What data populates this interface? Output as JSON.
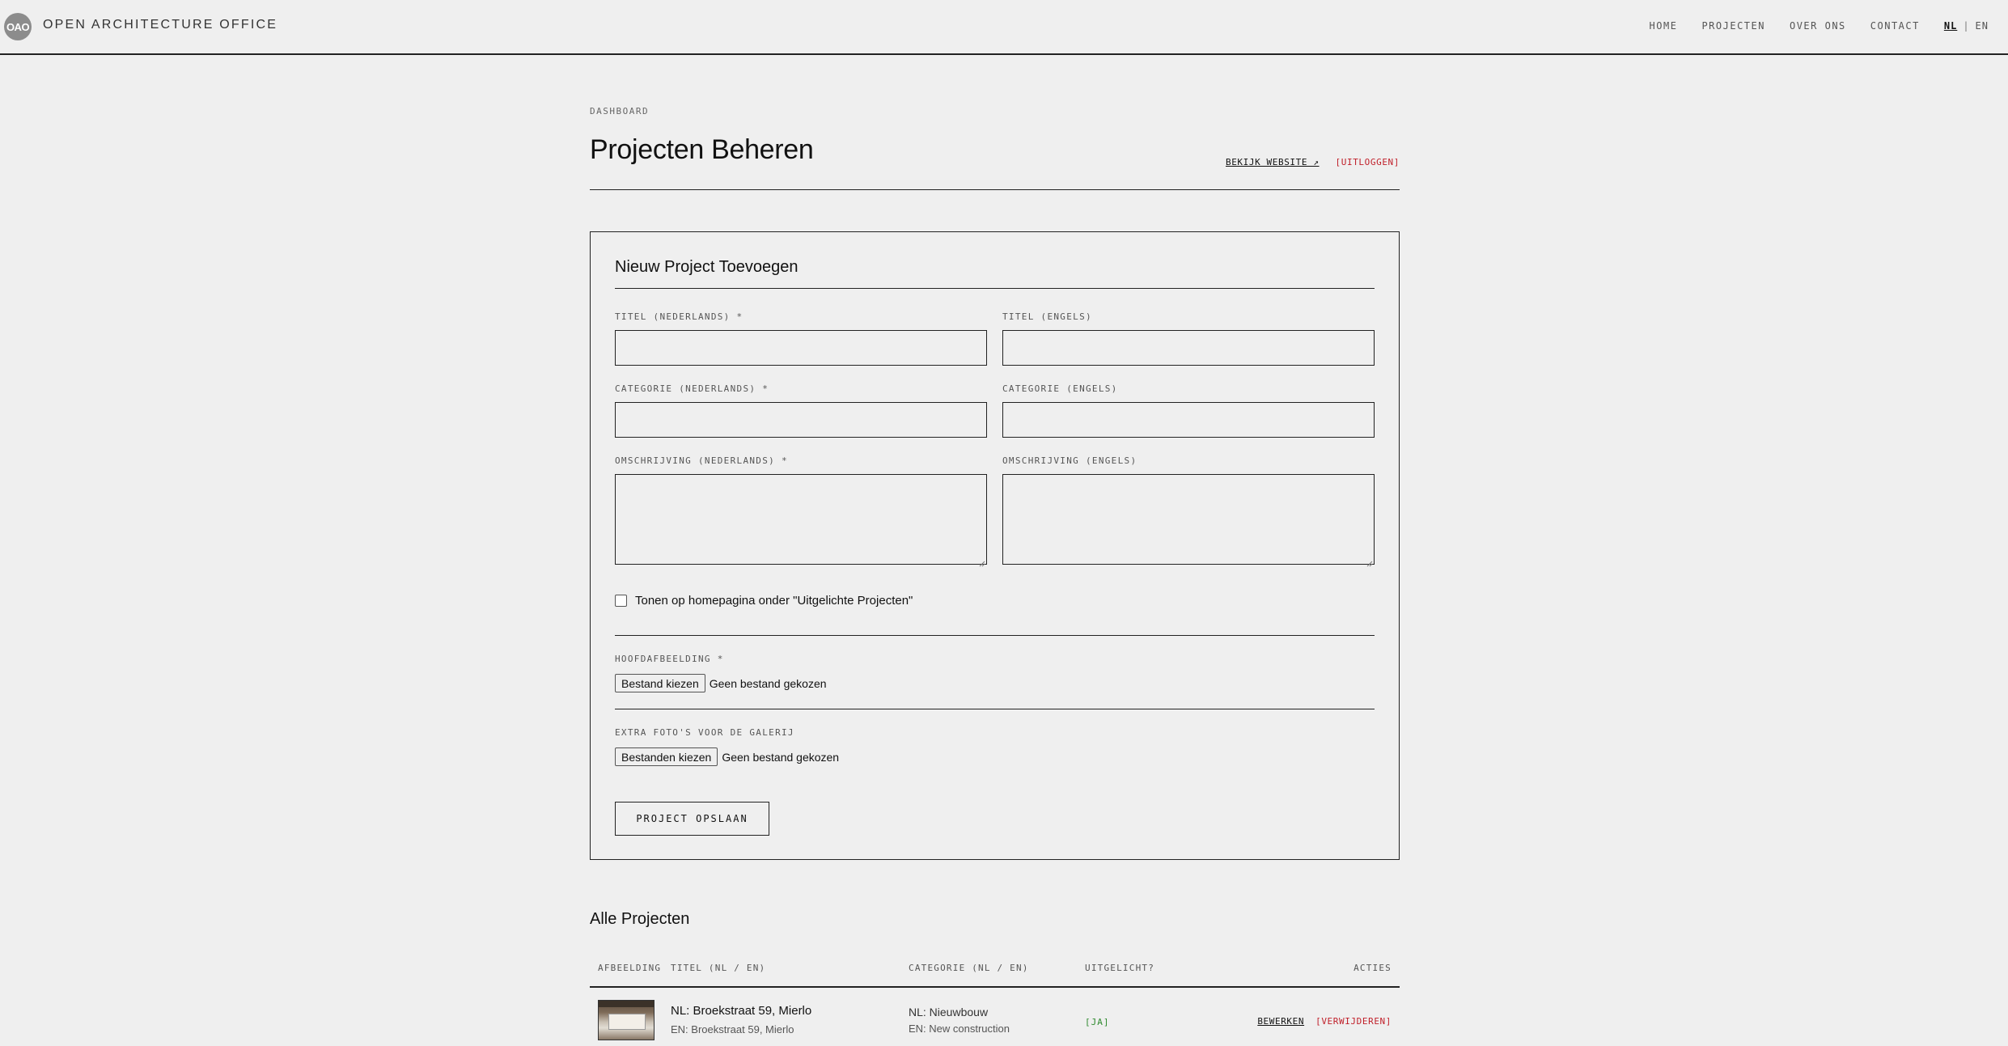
{
  "header": {
    "logo_text": "OAO",
    "brand": "OPEN ARCHITECTURE OFFICE",
    "nav": [
      "HOME",
      "PROJECTEN",
      "OVER ONS",
      "CONTACT"
    ],
    "lang_active": "NL",
    "lang_sep": "|",
    "lang_other": "EN"
  },
  "dashboard": {
    "breadcrumb": "DASHBOARD",
    "title": "Projecten Beheren",
    "view_site": "BEKIJK WEBSITE ↗",
    "logout": "[UITLOGGEN]"
  },
  "form": {
    "title": "Nieuw Project Toevoegen",
    "title_nl_label": "TITEL (NEDERLANDS) *",
    "title_en_label": "TITEL (ENGELS)",
    "category_nl_label": "CATEGORIE (NEDERLANDS) *",
    "category_en_label": "CATEGORIE (ENGELS)",
    "description_nl_label": "OMSCHRIJVING (NEDERLANDS) *",
    "description_en_label": "OMSCHRIJVING (ENGELS)",
    "title_nl_value": "",
    "title_en_value": "",
    "category_nl_value": "",
    "category_en_value": "",
    "featured_label": "Tonen op homepagina onder \"Uitgelichte Projecten\"",
    "featured_checked": false,
    "main_image_label": "HOOFDAFBEELDING *",
    "main_image_button": "Bestand kiezen",
    "main_image_status": "Geen bestand gekozen",
    "gallery_label": "EXTRA FOTO'S VOOR DE GALERIJ",
    "gallery_button": "Bestanden kiezen",
    "gallery_status": "Geen bestand gekozen",
    "save_button": "PROJECT OPSLAAN"
  },
  "projects": {
    "title": "Alle Projecten",
    "columns": [
      "AFBEELDING",
      "TITEL (NL / EN)",
      "CATEGORIE (NL / EN)",
      "UITGELICHT?",
      "ACTIES"
    ],
    "rows": [
      {
        "title_nl": "NL: Broekstraat 59, Mierlo",
        "title_en": "EN: Broekstraat 59, Mierlo",
        "category_nl": "NL: Nieuwbouw",
        "category_en": "EN: New construction",
        "featured": "[JA]",
        "edit": "BEWERKEN",
        "delete": "[VERWIJDEREN]"
      }
    ]
  },
  "colors": {
    "background": "#efefef",
    "text": "#111111",
    "danger": "#c0202a",
    "success": "#2f8a2f",
    "logo_circle": "#8c8c8c"
  }
}
